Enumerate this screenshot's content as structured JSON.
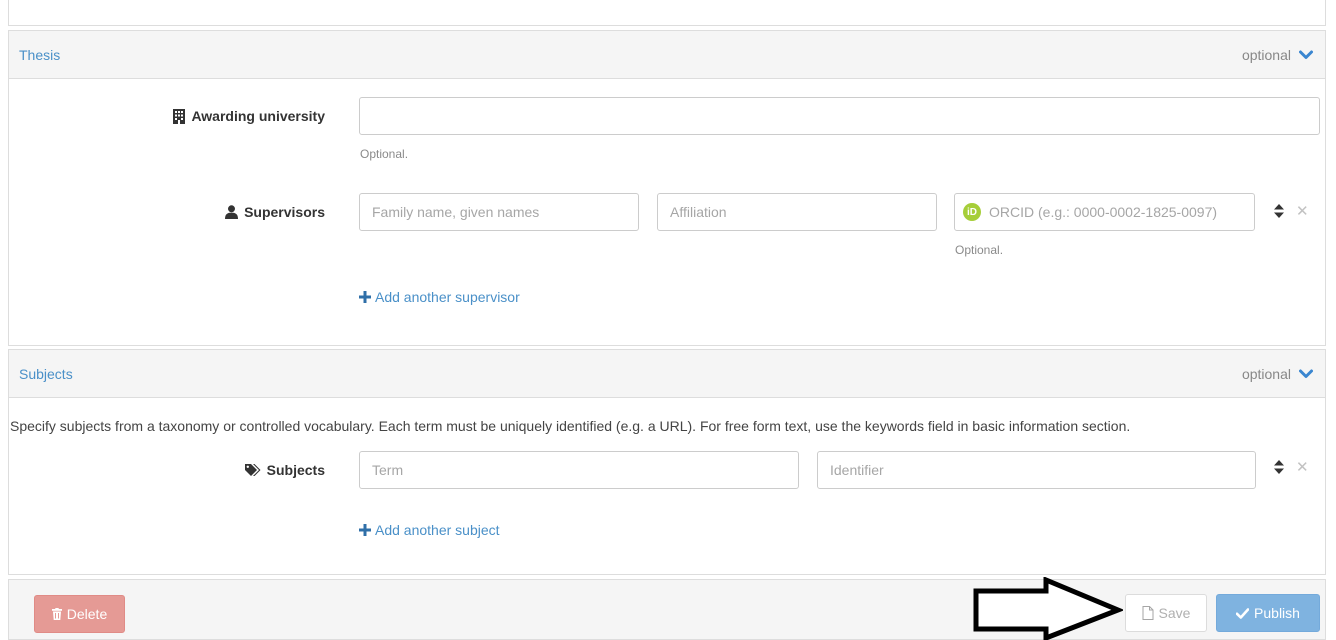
{
  "thesis": {
    "title": "Thesis",
    "optional": "optional",
    "awarding_university": {
      "label": "Awarding university",
      "value": "",
      "help": "Optional."
    },
    "supervisors": {
      "label": "Supervisors",
      "name_placeholder": "Family name, given names",
      "affiliation_placeholder": "Affiliation",
      "orcid_placeholder": "ORCID (e.g.: 0000-0002-1825-0097)",
      "orcid_help": "Optional.",
      "add_label": "Add another supervisor"
    }
  },
  "subjects": {
    "title": "Subjects",
    "optional": "optional",
    "description": "Specify subjects from a taxonomy or controlled vocabulary. Each term must be uniquely identified (e.g. a URL). For free form text, use the keywords field in basic information section.",
    "label": "Subjects",
    "term_placeholder": "Term",
    "identifier_placeholder": "Identifier",
    "add_label": "Add another subject"
  },
  "footer": {
    "delete_label": "Delete",
    "save_label": "Save",
    "publish_label": "Publish"
  },
  "colors": {
    "link": "#4a90c8",
    "delete": "#e59a95",
    "publish": "#7fb3e0",
    "orcid": "#a6ce39"
  }
}
